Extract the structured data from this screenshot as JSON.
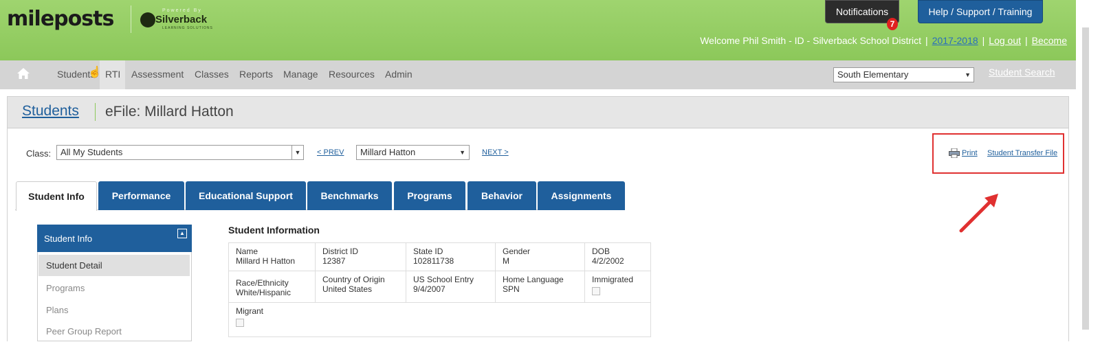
{
  "header": {
    "logo_text_a": "mileposts",
    "powered_by": "Powered By",
    "partner_name": "Silverback",
    "partner_sub": "LEARNING SOLUTIONS",
    "notifications_label": "Notifications",
    "notifications_count": "7",
    "help_label": "Help / Support / Training",
    "welcome": "Welcome Phil Smith - ID - Silverback School District",
    "year": "2017-2018",
    "logout": "Log out",
    "become": "Become"
  },
  "nav": {
    "items": [
      "Students",
      "RTI",
      "Assessment",
      "Classes",
      "Reports",
      "Manage",
      "Resources",
      "Admin"
    ],
    "school_select": "South Elementary",
    "student_search": "Student Search"
  },
  "page": {
    "breadcrumb": "Students",
    "title": "eFile: Millard Hatton",
    "class_label": "Class:",
    "class_value": "All My Students",
    "prev": "< PREV",
    "student_value": "Millard Hatton",
    "next": "NEXT >",
    "print": "Print",
    "transfer": "Student Transfer File"
  },
  "tabs": [
    "Student Info",
    "Performance",
    "Educational Support",
    "Benchmarks",
    "Programs",
    "Behavior",
    "Assignments"
  ],
  "sidebar": {
    "title": "Student Info",
    "items": [
      "Student Detail",
      "Programs",
      "Plans",
      "Peer Group Report"
    ]
  },
  "student_info": {
    "title": "Student Information",
    "name_label": "Name",
    "name": "Millard H Hatton",
    "district_label": "District ID",
    "district": "12387",
    "state_label": "State ID",
    "state": "102811738",
    "gender_label": "Gender",
    "gender": "M",
    "dob_label": "DOB",
    "dob": "4/2/2002",
    "race_label": "Race/Ethnicity",
    "race": "White/Hispanic",
    "country_label": "Country of Origin",
    "country": "United States",
    "entry_label": "US School Entry",
    "entry": "9/4/2007",
    "language_label": "Home Language",
    "language": "SPN",
    "immigrated_label": "Immigrated",
    "migrant_label": "Migrant"
  },
  "colors": {
    "header_green": "#8cc85a",
    "brand_blue": "#1f5f9c",
    "highlight_red": "#e03030"
  }
}
